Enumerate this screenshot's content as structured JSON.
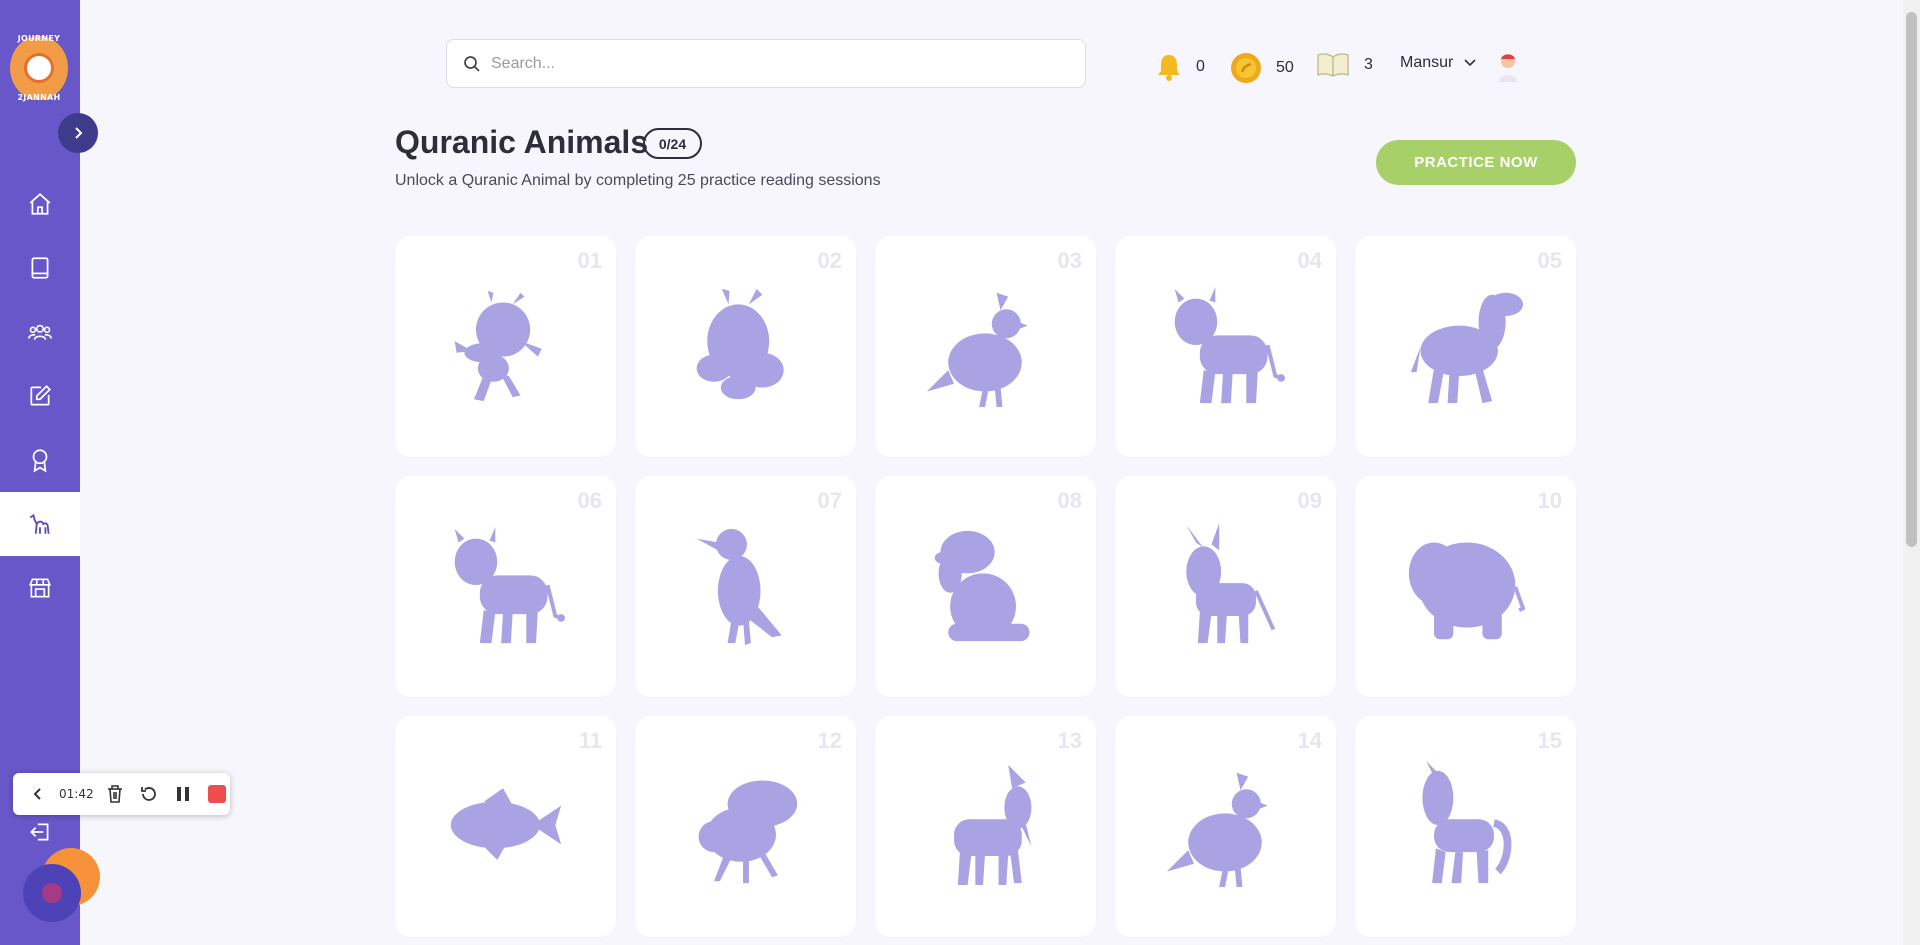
{
  "app": {
    "logo": {
      "top_text": "JOURNEY",
      "bottom_text": "2JANNAH"
    }
  },
  "sidebar": {
    "items": [
      {
        "name": "home",
        "icon": "home-icon",
        "active": false
      },
      {
        "name": "book",
        "icon": "book-icon",
        "active": false
      },
      {
        "name": "community",
        "icon": "community-icon",
        "active": false
      },
      {
        "name": "practice",
        "icon": "edit-icon",
        "active": false
      },
      {
        "name": "badges",
        "icon": "award-icon",
        "active": false
      },
      {
        "name": "animals",
        "icon": "camel-icon",
        "active": true
      },
      {
        "name": "store",
        "icon": "store-icon",
        "active": false
      }
    ],
    "logout_icon": "logout-icon"
  },
  "recorder": {
    "time": "01:42"
  },
  "header": {
    "search_placeholder": "Search...",
    "notifications": "0",
    "coins": "50",
    "books": "3",
    "username": "Mansur"
  },
  "page": {
    "title": "Quranic Animals",
    "progress": "0/24",
    "subtitle": "Unlock a Quranic Animal by completing 25 practice reading sessions",
    "practice_button": "PRACTICE NOW"
  },
  "animals": [
    {
      "num": "01",
      "shape": "ant"
    },
    {
      "num": "02",
      "shape": "bee"
    },
    {
      "num": "03",
      "shape": "quail"
    },
    {
      "num": "04",
      "shape": "cow"
    },
    {
      "num": "05",
      "shape": "camel"
    },
    {
      "num": "06",
      "shape": "cow"
    },
    {
      "num": "07",
      "shape": "crow"
    },
    {
      "num": "08",
      "shape": "dog"
    },
    {
      "num": "09",
      "shape": "donkey"
    },
    {
      "num": "10",
      "shape": "elephant"
    },
    {
      "num": "11",
      "shape": "fish"
    },
    {
      "num": "12",
      "shape": "fly"
    },
    {
      "num": "13",
      "shape": "goat"
    },
    {
      "num": "14",
      "shape": "quail"
    },
    {
      "num": "15",
      "shape": "horse"
    }
  ],
  "colors": {
    "sidebar": "#6757c9",
    "silhouette": "#a9a3e4",
    "practice_button": "#a8d069",
    "background": "#f6f6fc"
  }
}
